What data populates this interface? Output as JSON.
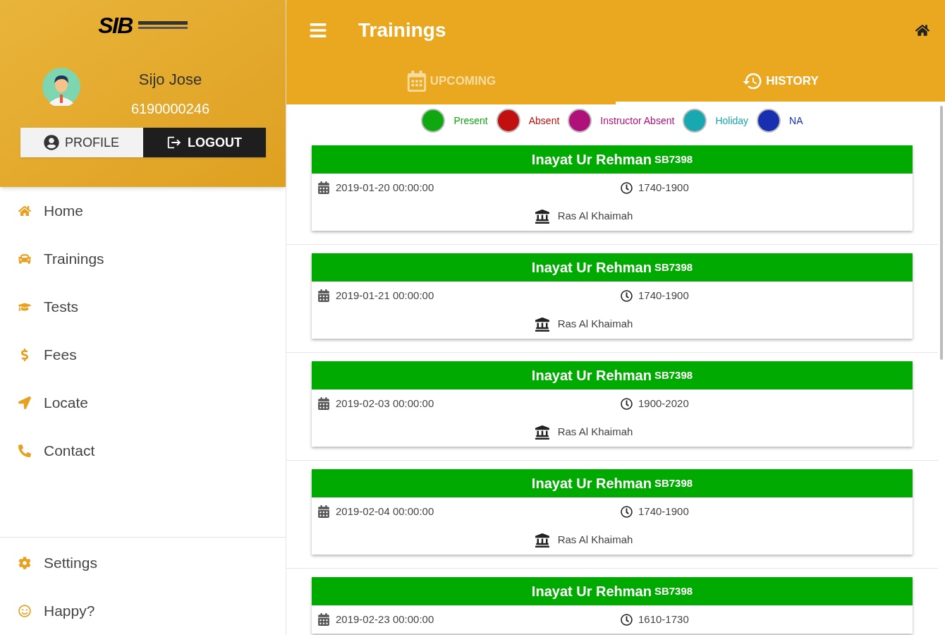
{
  "sidebar": {
    "logo": {
      "text": "SIB"
    },
    "user": {
      "name": "Sijo Jose",
      "number": "6190000246"
    },
    "buttons": [
      {
        "label": "PROFILE",
        "kind": "profile"
      },
      {
        "label": "LOGOUT",
        "kind": "logout"
      }
    ],
    "items": [
      {
        "label": "Home",
        "kind": "home"
      },
      {
        "label": "Trainings",
        "kind": "car"
      },
      {
        "label": "Tests",
        "kind": "cap"
      },
      {
        "label": "Fees",
        "kind": "dollar"
      },
      {
        "label": "Locate",
        "kind": "arrow"
      },
      {
        "label": "Contact",
        "kind": "phone"
      }
    ],
    "bottom_items": [
      {
        "label": "Settings",
        "kind": "gear"
      },
      {
        "label": "Happy?",
        "kind": "smile"
      }
    ]
  },
  "header": {
    "title": "Trainings"
  },
  "tabs": [
    {
      "label": "UPCOMING",
      "kind": "calendar",
      "selected": false
    },
    {
      "label": "HISTORY",
      "kind": "history",
      "selected": true
    }
  ],
  "legend": [
    {
      "label": "Present",
      "color": "#10a810"
    },
    {
      "label": "Absent",
      "color": "#c01010"
    },
    {
      "label": "Instructor Absent",
      "color": "#b0107a"
    },
    {
      "label": "Holiday",
      "color": "#18a8b0"
    },
    {
      "label": "NA",
      "color": "#1830b0"
    }
  ],
  "trainings": [
    {
      "instructor": "Inayat Ur Rehman",
      "code": "SB7398",
      "color": "#00aa00",
      "date": "2019-01-20 00:00:00",
      "time": "1740-1900",
      "location": "Ras Al Khaimah"
    },
    {
      "instructor": "Inayat Ur Rehman",
      "code": "SB7398",
      "color": "#00aa00",
      "date": "2019-01-21 00:00:00",
      "time": "1740-1900",
      "location": "Ras Al Khaimah"
    },
    {
      "instructor": "Inayat Ur Rehman",
      "code": "SB7398",
      "color": "#00aa00",
      "date": "2019-02-03 00:00:00",
      "time": "1900-2020",
      "location": "Ras Al Khaimah"
    },
    {
      "instructor": "Inayat Ur Rehman",
      "code": "SB7398",
      "color": "#00aa00",
      "date": "2019-02-04 00:00:00",
      "time": "1740-1900",
      "location": "Ras Al Khaimah"
    },
    {
      "instructor": "Inayat Ur Rehman",
      "code": "SB7398",
      "color": "#00aa00",
      "date": "2019-02-23 00:00:00",
      "time": "1610-1730"
    }
  ]
}
